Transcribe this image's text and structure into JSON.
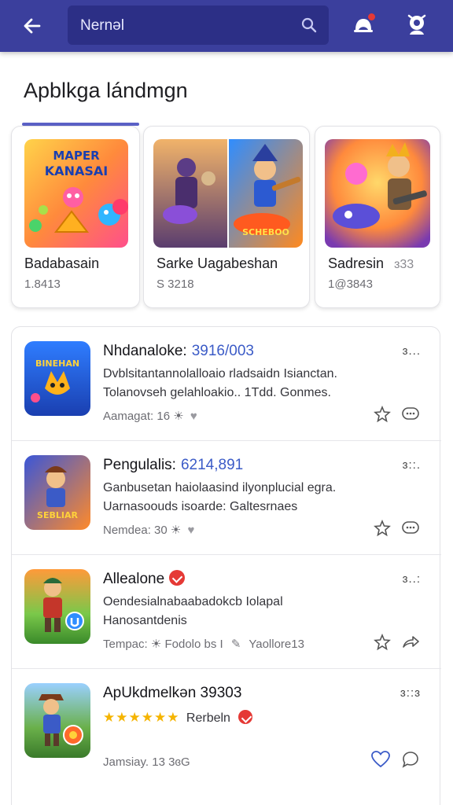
{
  "header": {
    "search_value": "Nernəl",
    "icons": [
      "back-arrow-icon",
      "search-icon",
      "notification-icon",
      "profile-icon"
    ],
    "accent_color": "#3b3f9d"
  },
  "section": {
    "title": "Apblkga lándmgn"
  },
  "featured": [
    {
      "name": "Badabasain",
      "meta": "1.8413",
      "art_text": "MAPER KANASAI"
    },
    {
      "name": "Sarke Uagabeshan",
      "meta": "S 3218",
      "art_text": "SCHEBOO"
    },
    {
      "name": "Sadresin",
      "badge": "ɜ33",
      "meta": "1@3843"
    }
  ],
  "list": [
    {
      "title": "Nhdanaloke:",
      "code": "3916/003",
      "desc1": "Dvblsitantannolalloaio rladsaidn Isianctan.",
      "desc2": "Tolanovseh gelahloakio.. 1Tdd. Gonmes.",
      "foot": "Aamagat: 16 ☀",
      "more": "ɜ...",
      "icon_text": "BINEHAN"
    },
    {
      "title": "Pengulalis:",
      "code": "6214,891",
      "desc1": "Ganbusetan haiolaasind ilyonplucial egra.",
      "desc2": "Uarnasoouds isoarde: Galtesrnaes",
      "foot": "Nemdea: 30 ☀",
      "more": "ɜ::.",
      "icon_text": "SEBLIAR"
    },
    {
      "title": "Allealone",
      "code": "",
      "desc1": "Oendesialnabaabadokcb Iolapal",
      "desc2": "Hanosantdenis",
      "foot": "Tempac: ☀ Fodolo bs I",
      "foot2": "Yaollore13",
      "more": "ɜ..:",
      "icon_text": ""
    },
    {
      "title": "ApUkdmelkən 39303",
      "code": "",
      "rating": "★★★★★★",
      "rating_label": "Rerbeln",
      "foot": "Jamsiay. 13 3ɞG",
      "more": "ɜ::ɜ",
      "icon_text": ""
    }
  ]
}
